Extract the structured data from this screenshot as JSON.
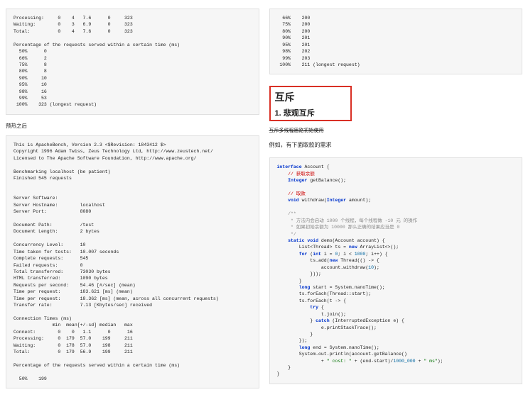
{
  "left": {
    "block1_lines": [
      "Processing:     0    4   7.6      0     323",
      "Waiting:        0    3   6.9      0     323",
      "Total:          0    4   7.6      0     323",
      "",
      "Percentage of the requests served within a certain time (ms)",
      "  50%      0",
      "  66%      2",
      "  75%      8",
      "  80%      8",
      "  90%     10",
      "  95%     10",
      "  98%     16",
      "  99%     53",
      " 100%    323 (longest request)"
    ],
    "caption": "预热之后",
    "block2_lines": [
      "This is ApacheBench, Version 2.3 <$Revision: 1843412 $>",
      "Copyright 1996 Adam Twiss, Zeus Technology Ltd, http://www.zeustech.net/",
      "Licensed to The Apache Software Foundation, http://www.apache.org/",
      "",
      "Benchmarking localhost (be patient)",
      "Finished 545 requests",
      "",
      "",
      "Server Software:",
      "Server Hostname:        localhost",
      "Server Port:            8080",
      "",
      "Document Path:          /test",
      "Document Length:        2 bytes",
      "",
      "Concurrency Level:      10",
      "Time taken for tests:   10.007 seconds",
      "Complete requests:      545",
      "Failed requests:        0",
      "Total transferred:      73030 bytes",
      "HTML transferred:       1090 bytes",
      "Requests per second:    54.46 [#/sec] (mean)",
      "Time per request:       183.621 [ms] (mean)",
      "Time per request:       18.362 [ms] (mean, across all concurrent requests)",
      "Transfer rate:          7.13 [Kbytes/sec] received",
      "",
      "Connection Times (ms)",
      "              min  mean[+/-sd] median   max",
      "Connect:        0    0   1.1      0      16",
      "Processing:     0  179  57.0    199     211",
      "Waiting:        0  178  57.0    198     211",
      "Total:          0  179  56.9    199     211",
      "",
      "Percentage of the requests served within a certain time (ms)",
      "",
      "  50%    199"
    ]
  },
  "right": {
    "block1_lines": [
      "  66%    200",
      "  75%    200",
      "  80%    200",
      "  90%    201",
      "  95%    201",
      "  98%    202",
      "  99%    203",
      " 100%    211 (longest request)"
    ],
    "heading": "互斥",
    "subheading": "1. 悲观互斥",
    "undernote": "互斥多线程思路初始使用",
    "para": "例如，有下面取款的需求",
    "code": {
      "l1a": "interface",
      "l1b": " Account {",
      "l2": "    // 获取余额",
      "l3a": "    Integer",
      "l3b": " getBalance();",
      "l4": "",
      "l5": "    // 取款",
      "l6a": "    void",
      "l6b": " withdraw(",
      "l6c": "Integer",
      "l6d": " amount);",
      "l7": "",
      "l8": "    /**",
      "l9": "     * 方法内会启动 1000 个线程，每个线程做 -10 元 的操作",
      "l10": "     * 如果初始余额为 10000 那么正确的结果应当是 0",
      "l11": "     */",
      "l12a": "    static void",
      "l12b": " demo(Account account) {",
      "l13a": "        List<Thread> ts = ",
      "l13b": "new",
      "l13c": " ArrayList<>();",
      "l14a": "        for",
      "l14b": " (",
      "l14c": "int",
      "l14d": " i = ",
      "l14e": "0",
      "l14f": "; i < ",
      "l14g": "1000",
      "l14h": "; i++) {",
      "l15a": "            ts.add(",
      "l15b": "new",
      "l15c": " Thread(() -> {",
      "l16a": "                account.withdraw(",
      "l16b": "10",
      "l16c": ");",
      "l17": "            }));",
      "l18": "        }",
      "l19a": "        long",
      "l19b": " start = System.nanoTime();",
      "l20": "        ts.forEach(Thread::start);",
      "l21": "        ts.forEach(t -> {",
      "l22a": "            try",
      "l22b": " {",
      "l23": "                t.join();",
      "l24a": "            } ",
      "l24b": "catch",
      "l24c": " (InterruptedException e) {",
      "l25": "                e.printStackTrace();",
      "l26": "            }",
      "l27": "        });",
      "l28a": "        long",
      "l28b": " end = System.nanoTime();",
      "l29": "        System.out.println(account.getBalance()",
      "l30a": "                + ",
      "l30b": "\" cost: \"",
      "l30c": " + (end-start)/",
      "l30d": "1000_000",
      "l30e": " + ",
      "l30f": "\" ms\"",
      "l30g": ");",
      "l31": "    }",
      "l32": "}"
    }
  }
}
